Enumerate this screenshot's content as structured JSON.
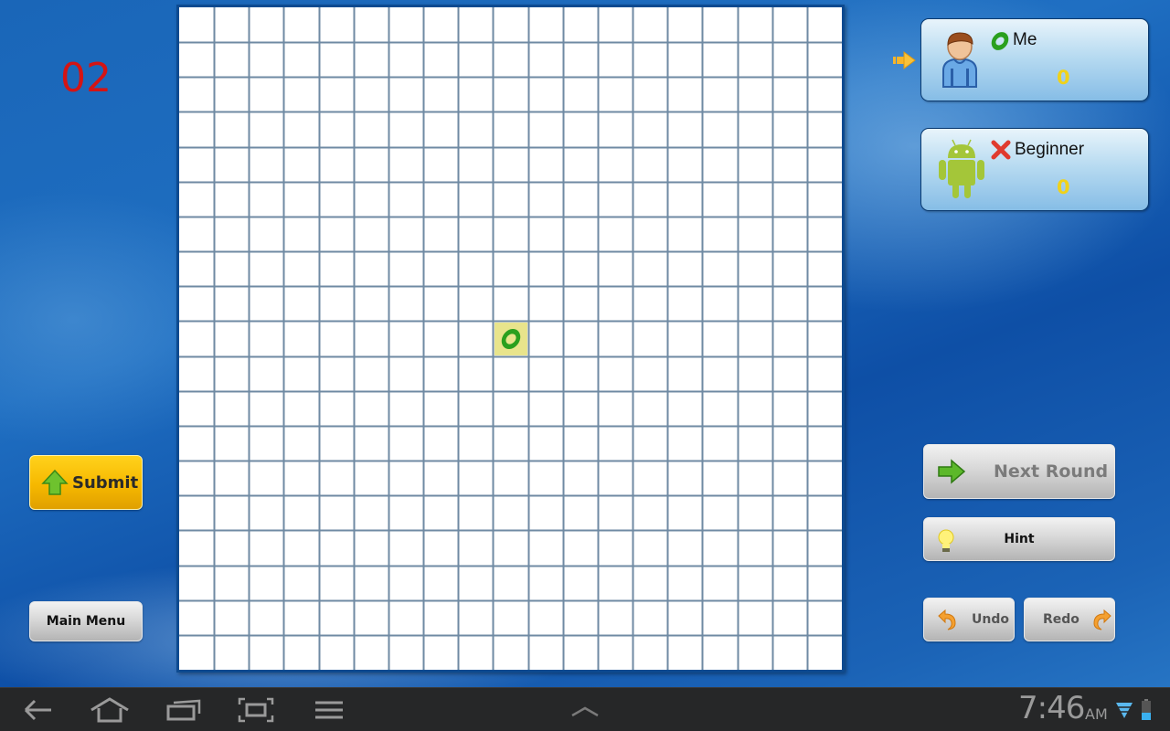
{
  "game": {
    "round_counter": "02",
    "board": {
      "rows": 19,
      "cols": 19,
      "pieces": [
        {
          "row": 9,
          "col": 9,
          "symbol": "O",
          "highlighted": true
        }
      ]
    },
    "current_turn_player": 0
  },
  "players": [
    {
      "name": "Me",
      "symbol": "O",
      "score": "0",
      "avatar": "person-avatar-icon"
    },
    {
      "name": "Beginner",
      "symbol": "X",
      "score": "0",
      "avatar": "android-avatar-icon"
    }
  ],
  "buttons": {
    "submit": "Submit",
    "main_menu": "Main Menu",
    "next_round": "Next Round",
    "hint": "Hint",
    "undo": "Undo",
    "redo": "Redo"
  },
  "colors": {
    "o_mark": "#2aa01e",
    "x_mark": "#e03a2e",
    "score": "#f0d21a",
    "round_counter": "#d41414",
    "highlight_cell": "#e8e48c",
    "grid_line": "#6f8aa3"
  },
  "system_bar": {
    "time": "7:46",
    "ampm": "AM",
    "nav_icons": [
      "back-icon",
      "home-icon",
      "recent-apps-icon",
      "screenshot-icon",
      "menu-icon",
      "chevron-up-icon"
    ],
    "status_icons": [
      "wifi-icon",
      "battery-icon"
    ]
  }
}
